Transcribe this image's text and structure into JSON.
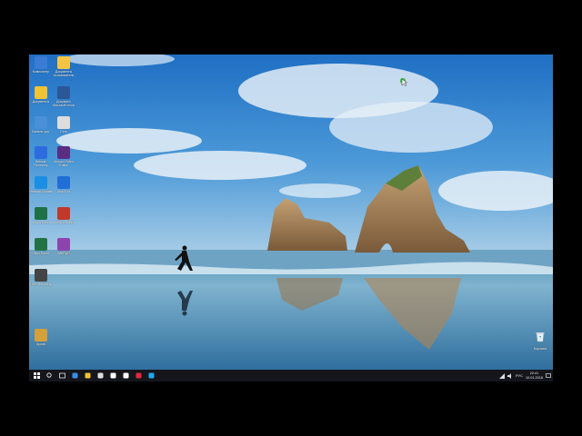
{
  "desktop": {
    "icons": [
      {
        "name": "recycle-like-icon-1",
        "label": "Компьютер",
        "color": "#3a7bd5"
      },
      {
        "name": "folder-icon",
        "label": "Документы пользователя",
        "color": "#f4c542"
      },
      {
        "name": "folder-yellow-icon",
        "label": "Документы",
        "color": "#f1c232"
      },
      {
        "name": "word-icon",
        "label": "Документ Microsoft Word",
        "color": "#2b5797"
      },
      {
        "name": "control-panel-icon",
        "label": "Панель упр.",
        "color": "#4a90d9"
      },
      {
        "name": "network-icon",
        "label": "Сеть",
        "color": "#dddddd"
      },
      {
        "name": "owl-icon",
        "label": "Hetman Recovery",
        "color": "#2d6cdf"
      },
      {
        "name": "media-icon",
        "label": "Movavi Video Editor",
        "color": "#5a2d82"
      },
      {
        "name": "gear-blue-icon",
        "label": "Hetman Update",
        "color": "#1a8fe3"
      },
      {
        "name": "hdd-icon",
        "label": "Disk Tool",
        "color": "#1f6fd6"
      },
      {
        "name": "excel-icon",
        "label": "Книга Excel",
        "color": "#1e7145"
      },
      {
        "name": "paint-icon",
        "label": "Movavi Screen",
        "color": "#c0392b"
      },
      {
        "name": "excel2-icon",
        "label": "Лист Excel",
        "color": "#217346"
      },
      {
        "name": "winrar-icon",
        "label": "WinRAR",
        "color": "#8e44ad"
      },
      {
        "name": "installer-icon",
        "label": "USB Recovery",
        "color": "#444444"
      },
      {
        "name": "archive-icon",
        "label": "Архив",
        "color": "#d4a03a"
      }
    ],
    "recycle_bin_label": "Корзина"
  },
  "taskbar": {
    "buttons": [
      {
        "name": "start-button-icon",
        "color": "#ffffff"
      },
      {
        "name": "search-icon",
        "color": "#ffffff"
      },
      {
        "name": "task-view-icon",
        "color": "#ffffff"
      },
      {
        "name": "edge-icon",
        "color": "#3c8ee5"
      },
      {
        "name": "file-explorer-icon",
        "color": "#f1c232"
      },
      {
        "name": "store-icon",
        "color": "#dddddd"
      },
      {
        "name": "mail-icon",
        "color": "#ffffff"
      },
      {
        "name": "yandex-icon",
        "color": "#ffffff"
      },
      {
        "name": "opera-icon",
        "color": "#e0293f"
      },
      {
        "name": "skype-icon",
        "color": "#1daaf1"
      }
    ],
    "tray": {
      "language": "РУС",
      "time": "22:41",
      "date": "10.01.2018"
    }
  }
}
